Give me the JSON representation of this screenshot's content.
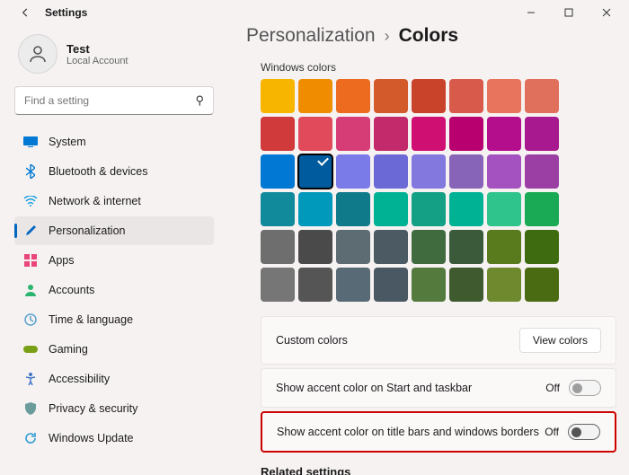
{
  "titlebar": {
    "title": "Settings"
  },
  "user": {
    "name": "Test",
    "subtitle": "Local Account"
  },
  "search": {
    "placeholder": "Find a setting"
  },
  "nav": [
    {
      "label": "System",
      "iconColor": "#0078d4",
      "key": "system"
    },
    {
      "label": "Bluetooth & devices",
      "iconColor": "#0078d4",
      "key": "bluetooth"
    },
    {
      "label": "Network & internet",
      "iconColor": "#1ba0e1",
      "key": "network"
    },
    {
      "label": "Personalization",
      "iconColor": "#0067c0",
      "key": "personalization",
      "selected": true
    },
    {
      "label": "Apps",
      "iconColor": "#e8467c",
      "key": "apps"
    },
    {
      "label": "Accounts",
      "iconColor": "#2cb56f",
      "key": "accounts"
    },
    {
      "label": "Time & language",
      "iconColor": "#5aa2d0",
      "key": "time"
    },
    {
      "label": "Gaming",
      "iconColor": "#7aa018",
      "key": "gaming"
    },
    {
      "label": "Accessibility",
      "iconColor": "#4178c7",
      "key": "accessibility"
    },
    {
      "label": "Privacy & security",
      "iconColor": "#6b9c9c",
      "key": "privacy"
    },
    {
      "label": "Windows Update",
      "iconColor": "#2e9bd6",
      "key": "update"
    }
  ],
  "breadcrumb": {
    "parent": "Personalization",
    "current": "Colors"
  },
  "colors": {
    "heading": "Windows colors",
    "selectedIndex": 17,
    "swatches": [
      "#f7b500",
      "#f08c00",
      "#ed6b1f",
      "#d35a2b",
      "#c9432a",
      "#d85a4a",
      "#e8745e",
      "#e0705c",
      "#d03a3a",
      "#e14a5a",
      "#d63d76",
      "#c22a6b",
      "#cf0f72",
      "#b8006e",
      "#b40e8d",
      "#a8188e",
      "#0078d4",
      "#005a9e",
      "#7a7ae8",
      "#6b69d6",
      "#8378de",
      "#8764b8",
      "#a352c0",
      "#9b3fa5",
      "#118a9c",
      "#0099bc",
      "#0f7a8a",
      "#00b294",
      "#13a085",
      "#00b294",
      "#2fc48c",
      "#1aaa55",
      "#6e6e6e",
      "#4a4a4a",
      "#5d6b73",
      "#4b5a63",
      "#3f6b3f",
      "#3a5a3a",
      "#5a7a1e",
      "#3f6b10",
      "#767676",
      "#555555",
      "#586a75",
      "#495863",
      "#547a3e",
      "#3e5a2e",
      "#6f8a2e",
      "#4a6b12"
    ]
  },
  "rows": {
    "custom": {
      "label": "Custom colors",
      "button": "View colors"
    },
    "taskbar": {
      "label": "Show accent color on Start and taskbar",
      "state": "Off"
    },
    "titlebars": {
      "label": "Show accent color on title bars and windows borders",
      "state": "Off"
    }
  },
  "related": {
    "heading": "Related settings"
  }
}
